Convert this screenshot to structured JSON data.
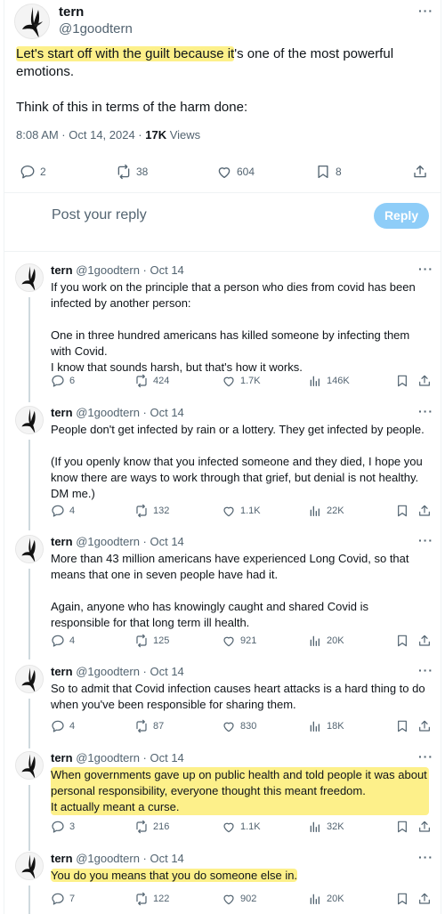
{
  "main_tweet": {
    "name": "tern",
    "handle": "@1goodtern",
    "text_highlight": "Let's start off with the guilt because it",
    "text_rest": "'s one of the most powerful emotions.",
    "text_p2": "Think of this in terms of the harm done:",
    "time": "8:08 AM · Oct 14, 2024 · ",
    "views_count": "17K",
    "views_label": " Views",
    "replies": "2",
    "reposts": "38",
    "likes": "604",
    "bookmarks": "8"
  },
  "composer": {
    "placeholder": "Post your reply",
    "button_label": "Reply"
  },
  "thread": [
    {
      "name": "tern",
      "handle_time": "@1goodtern · Oct 14",
      "paragraphs": [
        "If you work on the principle that a person who dies from covid has been infected by another person:",
        "One in three hundred americans has killed someone by infecting them with Covid.\nI know that sounds harsh, but that's how it works."
      ],
      "highlight": [],
      "replies": "6",
      "reposts": "424",
      "likes": "1.7K",
      "views": "146K"
    },
    {
      "name": "tern",
      "handle_time": "@1goodtern · Oct 14",
      "paragraphs": [
        "People don't get infected by rain or a lottery. They get infected by people.",
        "(If you openly know that you infected someone and they died, I hope you know there are ways to work through that grief, but denial is not healthy. DM me.)"
      ],
      "highlight": [],
      "replies": "4",
      "reposts": "132",
      "likes": "1.1K",
      "views": "22K"
    },
    {
      "name": "tern",
      "handle_time": "@1goodtern · Oct 14",
      "paragraphs": [
        "More than 43 million americans have experienced Long Covid, so that means that one in seven people have had it.",
        "Again, anyone who has knowingly caught and shared Covid is responsible for that long term ill health."
      ],
      "highlight": [],
      "replies": "4",
      "reposts": "125",
      "likes": "921",
      "views": "20K"
    },
    {
      "name": "tern",
      "handle_time": "@1goodtern · Oct 14",
      "paragraphs": [
        "So to admit that Covid infection causes heart attacks is a hard thing to do when you've been responsible for sharing them."
      ],
      "highlight": [],
      "replies": "4",
      "reposts": "87",
      "likes": "830",
      "views": "18K"
    },
    {
      "name": "tern",
      "handle_time": "@1goodtern · Oct 14",
      "paragraphs": [
        "When governments gave up on public health and told people it was about personal responsibility, everyone thought this meant freedom.\nIt actually meant a curse."
      ],
      "highlight": [
        0
      ],
      "replies": "3",
      "reposts": "216",
      "likes": "1.1K",
      "views": "32K"
    },
    {
      "name": "tern",
      "handle_time": "@1goodtern · Oct 14",
      "paragraphs": [
        "You do you means that you do someone else in."
      ],
      "highlight": [
        0
      ],
      "replies": "7",
      "reposts": "122",
      "likes": "902",
      "views": "20K"
    }
  ],
  "colors": {
    "accent": "#1d9bf0",
    "reply_button": "#8ecdf8",
    "highlight": "#fdf08a",
    "secondary_text": "#536471"
  },
  "icons": [
    "bird-avatar-icon",
    "more-icon",
    "reply-icon",
    "repost-icon",
    "like-icon",
    "bookmark-icon",
    "share-icon",
    "views-icon"
  ]
}
